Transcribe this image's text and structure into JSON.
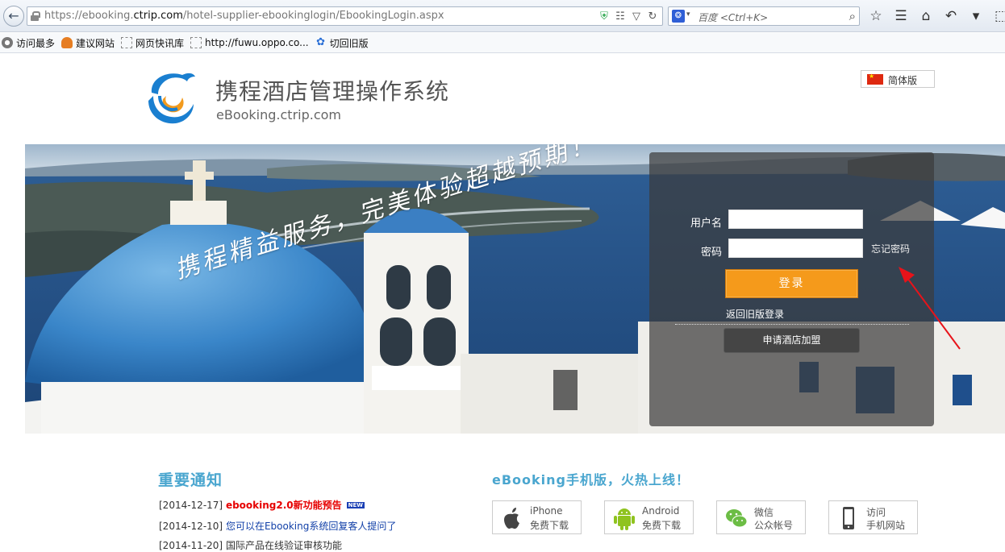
{
  "browser": {
    "url_prefix": "https://ebooking.",
    "url_domain": "ctrip.com",
    "url_path": "/hotel-supplier-ebookinglogin/EbookingLogin.aspx",
    "search_placeholder": "百度 <Ctrl+K>",
    "bookmarks": [
      "访问最多",
      "建议网站",
      "网页快讯库",
      "http://fuwu.oppo.co...",
      "切回旧版"
    ]
  },
  "header": {
    "site_name": "携程酒店管理操作系统",
    "site_url": "eBooking.ctrip.com",
    "language_label": "简体版"
  },
  "banner": {
    "slogan": "携程精益服务，完美体验超越预期！"
  },
  "login": {
    "username_label": "用户名",
    "password_label": "密码",
    "username_value": "",
    "password_value": "",
    "forgot_label": "忘记密码",
    "login_button": "登录",
    "old_version_link": "返回旧版登录",
    "join_button": "申请酒店加盟"
  },
  "notices": {
    "title": "重要通知",
    "items": [
      {
        "date": "[2014-12-17]",
        "text": "ebooking2.0新功能预告",
        "badge": "NEW"
      },
      {
        "date": "[2014-12-10]",
        "text": "您可以在Ebooking系统回复客人提问了"
      },
      {
        "date": "[2014-11-20]",
        "text": "国际产品在线验证审核功能"
      }
    ]
  },
  "mobile": {
    "title": "eBooking手机版，火热上线！",
    "apps": [
      {
        "line1": "iPhone",
        "line2": "免费下载"
      },
      {
        "line1": "Android",
        "line2": "免费下载"
      },
      {
        "line1": "微信",
        "line2": "公众帐号"
      },
      {
        "line1": "访问",
        "line2": "手机网站"
      }
    ]
  },
  "colors": {
    "accent_orange": "#f59a1b",
    "title_blue": "#4aa6cf",
    "hot_red": "#e60000",
    "link_blue": "#1240a8"
  }
}
